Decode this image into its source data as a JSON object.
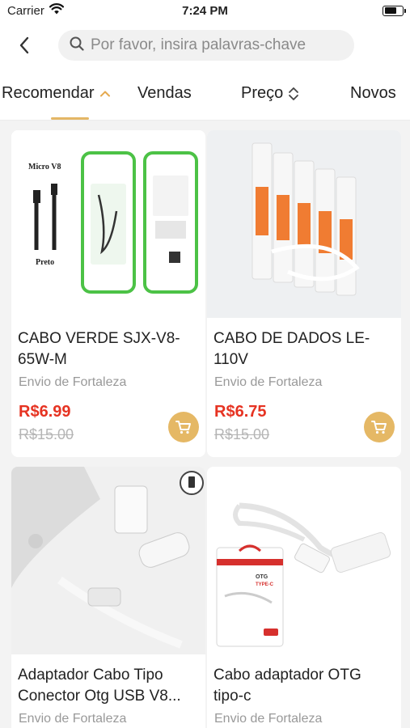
{
  "status_bar": {
    "carrier": "Carrier",
    "time": "7:24 PM",
    "battery_level": 0.7
  },
  "search": {
    "placeholder": "Por favor, insira palavras-chave",
    "value": ""
  },
  "sort_tabs": [
    {
      "label": "Recomendar",
      "active": true
    },
    {
      "label": "Vendas",
      "active": false
    },
    {
      "label": "Preço",
      "active": false
    },
    {
      "label": "Novos",
      "active": false
    }
  ],
  "products": [
    {
      "title": "CABO VERDE SJX-V8-65W-M",
      "origin": "Envio de Fortaleza",
      "price": "R$6.99",
      "old_price": "R$15.00",
      "image_text": {
        "label1": "Micro V8",
        "label2": "Preto"
      }
    },
    {
      "title": "CABO DE DADOS LE-110V",
      "origin": "Envio de Fortaleza",
      "price": "R$6.75",
      "old_price": "R$15.00"
    },
    {
      "title": "Adaptador Cabo Tipo Conector Otg USB V8...",
      "origin": "Envio de Fortaleza"
    },
    {
      "title": "Cabo adaptador OTG tipo-c",
      "origin": "Envio de Fortaleza",
      "image_text": {
        "label1": "OTG",
        "label2": "TYPE-C"
      }
    }
  ],
  "colors": {
    "accent": "#e5b865",
    "price": "#e63322",
    "muted": "#999999"
  }
}
